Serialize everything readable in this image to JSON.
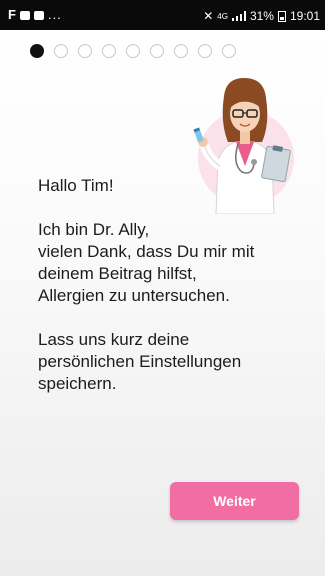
{
  "status_bar": {
    "left_icons": [
      "notification-f-icon",
      "gallery-icon",
      "gallery-icon"
    ],
    "more_indicator": "...",
    "network": "4G",
    "battery_percent": "31%",
    "time": "19:01"
  },
  "progress": {
    "total_steps": 9,
    "current_step": 1
  },
  "illustration": {
    "icon": "doctor-avatar-icon"
  },
  "message": {
    "greeting": "Hallo Tim!",
    "intro": "Ich bin Dr. Ally,\nvielen Dank, dass Du mir mit\ndeinem Beitrag hilfst,\nAllergien zu untersuchen.",
    "request": "Lass uns kurz deine\npersönlichen Einstellungen\nspeichern."
  },
  "button": {
    "label": "Weiter"
  },
  "colors": {
    "accent": "#f06ea3",
    "status_bar": "#0a0a0a",
    "active_dot": "#111111"
  }
}
